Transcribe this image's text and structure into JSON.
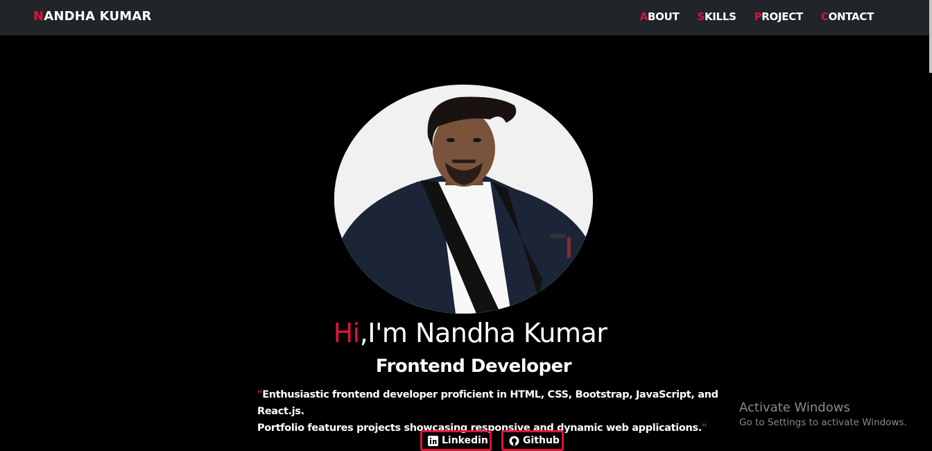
{
  "navbar": {
    "brand_initial": "N",
    "brand_rest": "ANDHA KUMAR",
    "links": [
      {
        "initial": "A",
        "rest": "BOUT"
      },
      {
        "initial": "S",
        "rest": "KILLS"
      },
      {
        "initial": "P",
        "rest": "ROJECT"
      },
      {
        "initial": "C",
        "rest": "ONTACT"
      }
    ]
  },
  "hero": {
    "greeting_hi": "Hi",
    "greeting_rest": ",I'm Nandha Kumar",
    "role": "Frontend Developer",
    "bio_line1": "Enthusiastic frontend developer proficient in HTML, CSS, Bootstrap, JavaScript, and React.js.",
    "bio_line2": "Portfolio features projects showcasing responsive and dynamic web applications.",
    "quote_mark": "\""
  },
  "buttons": {
    "linkedin_label": "Linkedin",
    "github_label": "Github"
  },
  "watermark": {
    "title": "Activate Windows",
    "subtitle": "Go to Settings to activate Windows."
  },
  "colors": {
    "accent": "#dc143c",
    "navbar_bg": "#212529",
    "page_bg": "#000000",
    "text": "#ffffff"
  },
  "icons": [
    "linkedin-icon",
    "github-icon"
  ]
}
